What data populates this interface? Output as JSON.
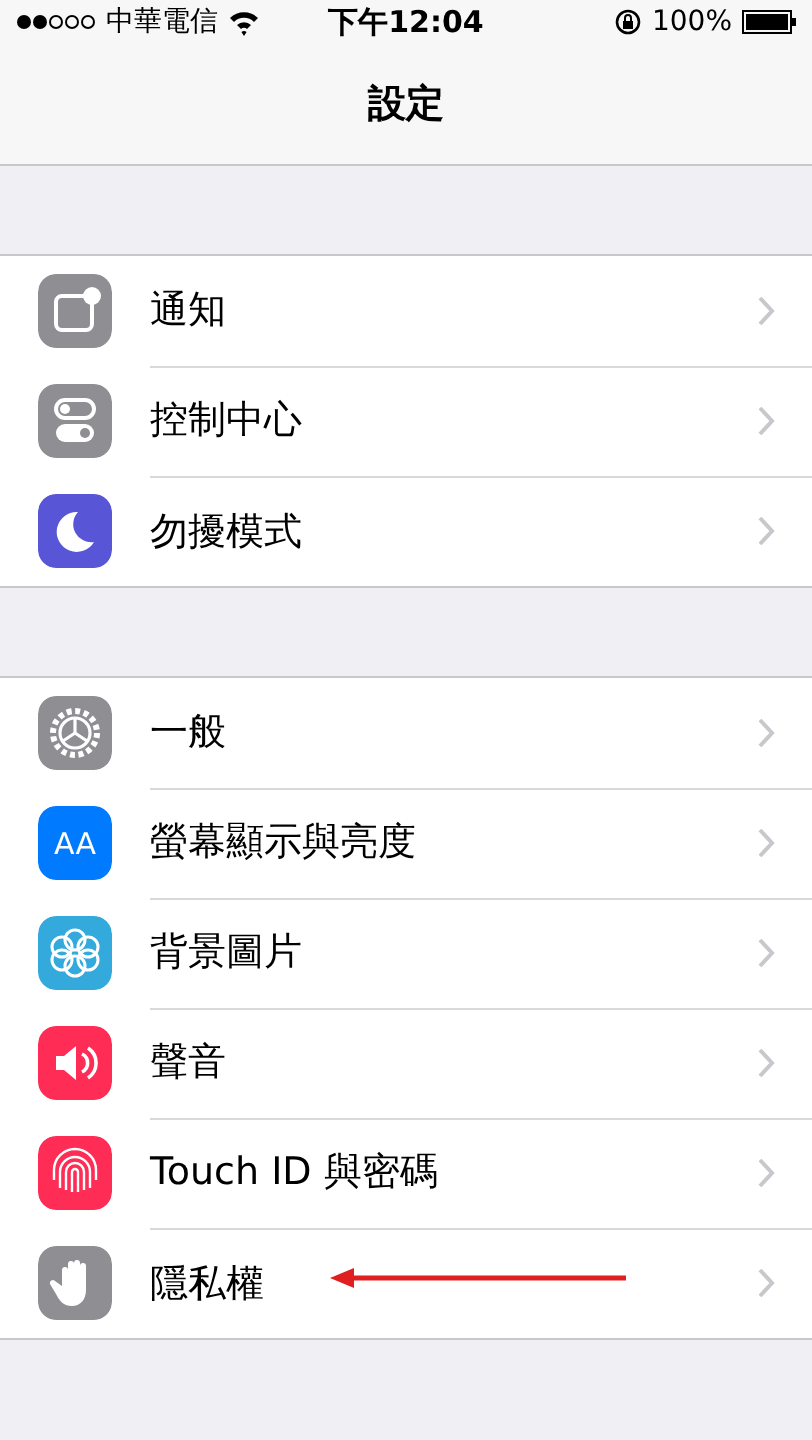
{
  "status_bar": {
    "carrier": "中華電信",
    "time": "下午12:04",
    "battery": "100%"
  },
  "nav": {
    "title": "設定"
  },
  "groups": [
    {
      "items": [
        {
          "label": "通知",
          "color": "#8e8e93",
          "marked": false
        },
        {
          "label": "控制中心",
          "color": "#8e8e93",
          "marked": false
        },
        {
          "label": "勿擾模式",
          "color": "#5856d6",
          "marked": false
        }
      ]
    },
    {
      "items": [
        {
          "label": "一般",
          "color": "#8e8e93",
          "marked": false
        },
        {
          "label": "螢幕顯示與亮度",
          "color": "#007aff",
          "icon_text": "AA",
          "marked": false
        },
        {
          "label": "背景圖片",
          "color": "#34aadc",
          "marked": false
        },
        {
          "label": "聲音",
          "color": "#ff2d55",
          "marked": false
        },
        {
          "label": "Touch ID 與密碼",
          "color": "#ff2d55",
          "marked": false
        },
        {
          "label": "隱私權",
          "color": "#8e8e93",
          "marked": true
        }
      ]
    }
  ]
}
